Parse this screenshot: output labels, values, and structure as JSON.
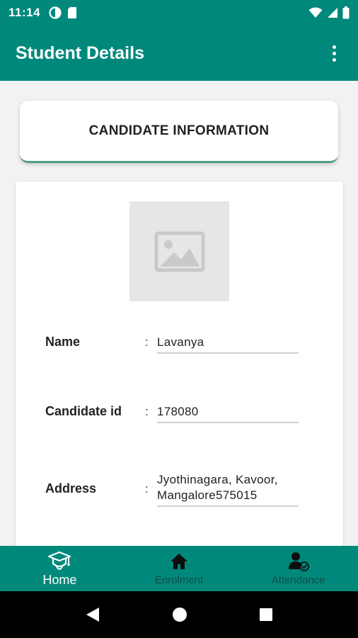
{
  "status_bar": {
    "time": "11:14"
  },
  "app_bar": {
    "title": "Student Details"
  },
  "header_card": {
    "title": "CANDIDATE INFORMATION"
  },
  "candidate": {
    "fields": [
      {
        "label": "Name",
        "colon": ":",
        "value": "Lavanya"
      },
      {
        "label": "Candidate id",
        "colon": ":",
        "value": "178080"
      },
      {
        "label": "Address",
        "colon": ":",
        "value": "Jyothinagara, Kavoor, Mangalore575015"
      }
    ]
  },
  "bottom_nav": {
    "items": [
      {
        "label": "Home",
        "icon": "graduation-cap-icon",
        "active": true
      },
      {
        "label": "Enrolment",
        "icon": "home-icon",
        "active": false
      },
      {
        "label": "Attendance",
        "icon": "user-check-icon",
        "active": false
      }
    ]
  },
  "colors": {
    "primary": "#00897b",
    "accent_line": "#4e9e8a",
    "background": "#f2f2f2"
  }
}
